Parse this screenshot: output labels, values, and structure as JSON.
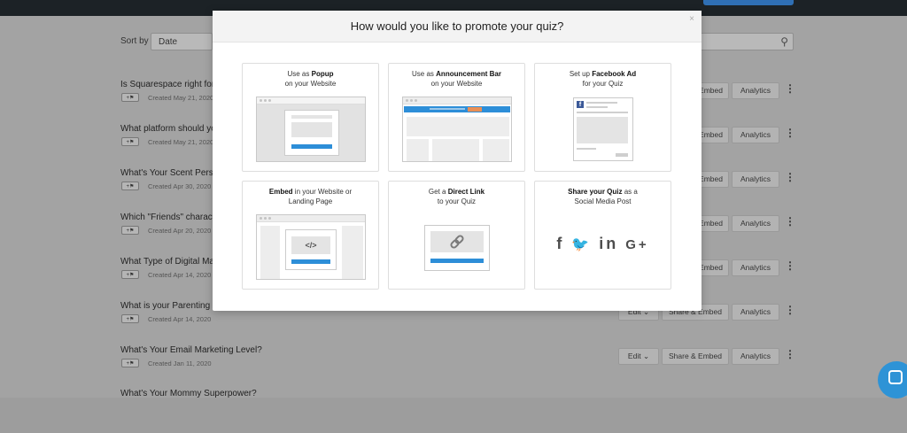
{
  "background": {
    "sort_label": "Sort by",
    "sort_value": "Date",
    "rows": [
      {
        "title": "Is Squarespace right for",
        "created": "Created May 21, 2020",
        "share": "& Embed",
        "analytics": "Analytics"
      },
      {
        "title": "What platform should yo",
        "created": "Created May 21, 2020",
        "share": "& Embed",
        "analytics": "Analytics"
      },
      {
        "title": "What's Your Scent Perso",
        "created": "Created Apr 30, 2020",
        "share": "& Embed",
        "analytics": "Analytics"
      },
      {
        "title": "Which \"Friends\" characte",
        "created": "Created Apr 20, 2020",
        "share": "& Embed",
        "analytics": "Analytics"
      },
      {
        "title": "What Type of Digital Ma",
        "created": "Created Apr 14, 2020",
        "share": "& Embed",
        "analytics": "Analytics"
      },
      {
        "title": "What is your Parenting S",
        "created": "Created Apr 14, 2020",
        "edit": "Edit",
        "share": "Share & Embed",
        "analytics": "Analytics"
      },
      {
        "title": "What's Your Email Marketing Level?",
        "created": "Created Jan 11, 2020",
        "edit": "Edit",
        "share": "Share & Embed",
        "analytics": "Analytics"
      },
      {
        "title": "What's Your Mommy Superpower?",
        "created": "",
        "share": "",
        "analytics": ""
      }
    ]
  },
  "modal": {
    "title": "How would you like to promote your quiz?",
    "close": "×",
    "cards": [
      {
        "pre": "Use as ",
        "bold": "Popup",
        "post": "",
        "line2": "on your Website"
      },
      {
        "pre": "Use as ",
        "bold": "Announcement Bar",
        "post": "",
        "line2": "on your Website"
      },
      {
        "pre": "Set up ",
        "bold": "Facebook Ad",
        "post": "",
        "line2": "for your Quiz"
      },
      {
        "pre": "",
        "bold": "Embed",
        "post": " in your Website or",
        "line2": "Landing Page"
      },
      {
        "pre": "Get a ",
        "bold": "Direct Link",
        "post": "",
        "line2": "to your Quiz"
      },
      {
        "pre": "",
        "bold": "Share your Quiz",
        "post": " as a",
        "line2": "Social Media Post"
      }
    ],
    "social_icons": [
      "facebook-icon",
      "twitter-icon",
      "linkedin-icon",
      "google-plus-icon"
    ],
    "embed_code": "</>"
  },
  "colors": {
    "accent": "#2d8ed8",
    "orange": "#e98f55"
  }
}
